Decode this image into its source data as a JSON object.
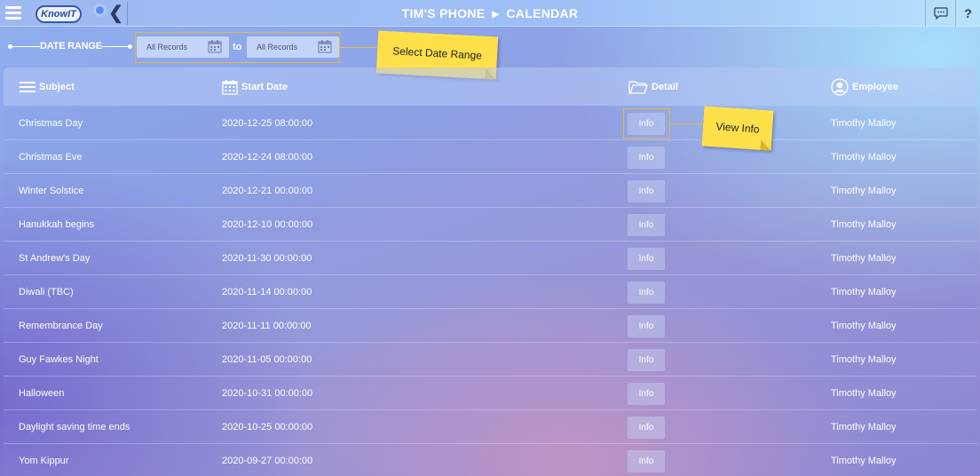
{
  "header": {
    "logo_text": "KnowIT",
    "device": "TIM'S PHONE",
    "section": "CALENDAR",
    "separator": "▶"
  },
  "date_range": {
    "label": "DATE RANGE",
    "from_value": "All Records",
    "to_label": "to",
    "to_value": "All Records"
  },
  "annotations": {
    "select_range": "Select Date Range",
    "view_info": "View Info"
  },
  "table": {
    "columns": {
      "subject": "Subject",
      "start_date": "Start Date",
      "detail": "Detail",
      "employee": "Employee"
    },
    "info_label": "Info",
    "rows": [
      {
        "subject": "Christmas Day",
        "start_date": "2020-12-25 08:00:00",
        "employee": "Timothy Malloy"
      },
      {
        "subject": "Christmas Eve",
        "start_date": "2020-12-24 08:00:00",
        "employee": "Timothy Malloy"
      },
      {
        "subject": "Winter Solstice",
        "start_date": "2020-12-21 00:00:00",
        "employee": "Timothy Malloy"
      },
      {
        "subject": "Hanukkah begins",
        "start_date": "2020-12-10 00:00:00",
        "employee": "Timothy Malloy"
      },
      {
        "subject": "St Andrew's Day",
        "start_date": "2020-11-30 00:00:00",
        "employee": "Timothy Malloy"
      },
      {
        "subject": "Diwali (TBC)",
        "start_date": "2020-11-14 00:00:00",
        "employee": "Timothy Malloy"
      },
      {
        "subject": "Remembrance Day",
        "start_date": "2020-11-11 00:00:00",
        "employee": "Timothy Malloy"
      },
      {
        "subject": "Guy Fawkes Night",
        "start_date": "2020-11-05 00:00:00",
        "employee": "Timothy Malloy"
      },
      {
        "subject": "Halloween",
        "start_date": "2020-10-31 00:00:00",
        "employee": "Timothy Malloy"
      },
      {
        "subject": "Daylight saving time ends",
        "start_date": "2020-10-25 00:00:00",
        "employee": "Timothy Malloy"
      },
      {
        "subject": "Yom Kippur",
        "start_date": "2020-09-27 00:00:00",
        "employee": "Timothy Malloy"
      }
    ]
  }
}
